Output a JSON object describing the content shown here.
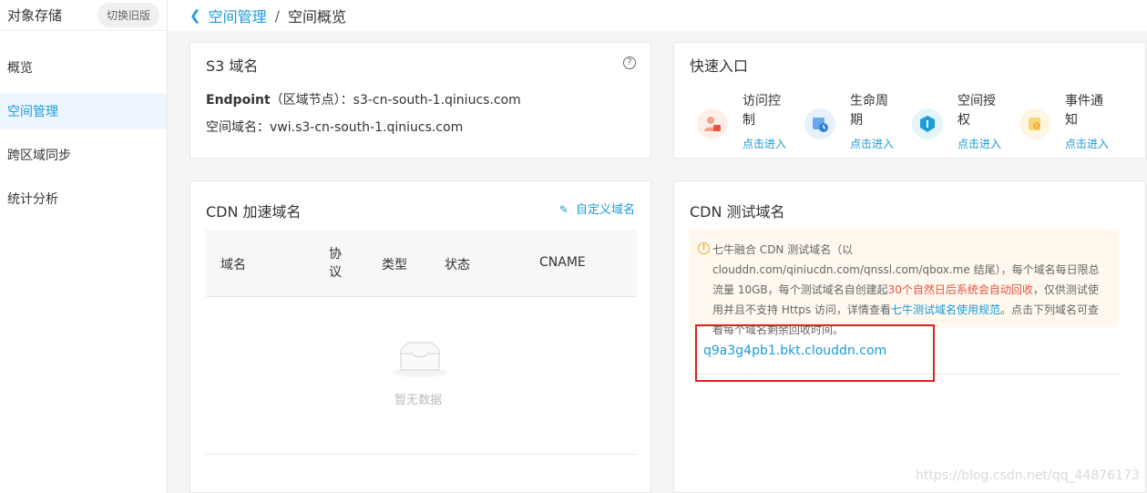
{
  "sidebar": {
    "title": "对象存储",
    "switch_label": "切换旧版",
    "items": [
      {
        "label": "概览"
      },
      {
        "label": "空间管理"
      },
      {
        "label": "跨区域同步"
      },
      {
        "label": "统计分析"
      }
    ],
    "active_index": 1
  },
  "header": {
    "back_icon": "chevron-left-icon",
    "crumb_parent": "空间管理",
    "separator": "/",
    "crumb_current": "空间概览"
  },
  "s3": {
    "title": "S3 域名",
    "help_icon": "question-circle-icon",
    "endpoint_label": "Endpoint",
    "endpoint_note": "（区域节点）：",
    "endpoint_value": "s3-cn-south-1.qiniucs.com",
    "space_domain_label": "空间域名：",
    "space_domain_value": "vwi.s3-cn-south-1.qiniucs.com"
  },
  "quick": {
    "title": "快速入口",
    "items": [
      {
        "label": "访问控制",
        "link": "点击进入",
        "icon": "access-control-icon",
        "color": "#f0785a",
        "bg": "#fdeeea"
      },
      {
        "label": "生命周期",
        "link": "点击进入",
        "icon": "lifecycle-icon",
        "color": "#3a8ee6",
        "bg": "#e6f1fc"
      },
      {
        "label": "空间授权",
        "link": "点击进入",
        "icon": "space-auth-icon",
        "color": "#1aa0d8",
        "bg": "#e3f4fb"
      },
      {
        "label": "事件通知",
        "link": "点击进入",
        "icon": "event-notify-icon",
        "color": "#f5c04a",
        "bg": "#fdf6e3"
      }
    ]
  },
  "cdn": {
    "title": "CDN 加速域名",
    "custom_link": "自定义域名",
    "columns": [
      "域名",
      "协议",
      "类型",
      "状态",
      "CNAME"
    ],
    "empty_text": "暂无数据"
  },
  "test": {
    "title": "CDN 测试域名",
    "notice_p1": "七牛融合 CDN 测试域名（以 clouddn.com/qiniucdn.com/qnssl.com/qbox.me 结尾），每个域名每日限总流量 10GB，每个测试域名自创建起",
    "notice_red": "30个自然日后系统会自动回收",
    "notice_p2": "，仅供测试使用并且不支持 Https 访问，详情查看",
    "notice_link": "七牛测试域名使用规范",
    "notice_p3": "。点击下列域名可查看每个域名剩余回收时间。",
    "domain": "q9a3g4pb1.bkt.clouddn.com"
  },
  "watermark": "https://blog.csdn.net/qq_44876173",
  "colors": {
    "accent": "#1b9ad8",
    "warning": "#f0a52b",
    "danger": "#e8523f",
    "highlight_box": "#e02020"
  }
}
